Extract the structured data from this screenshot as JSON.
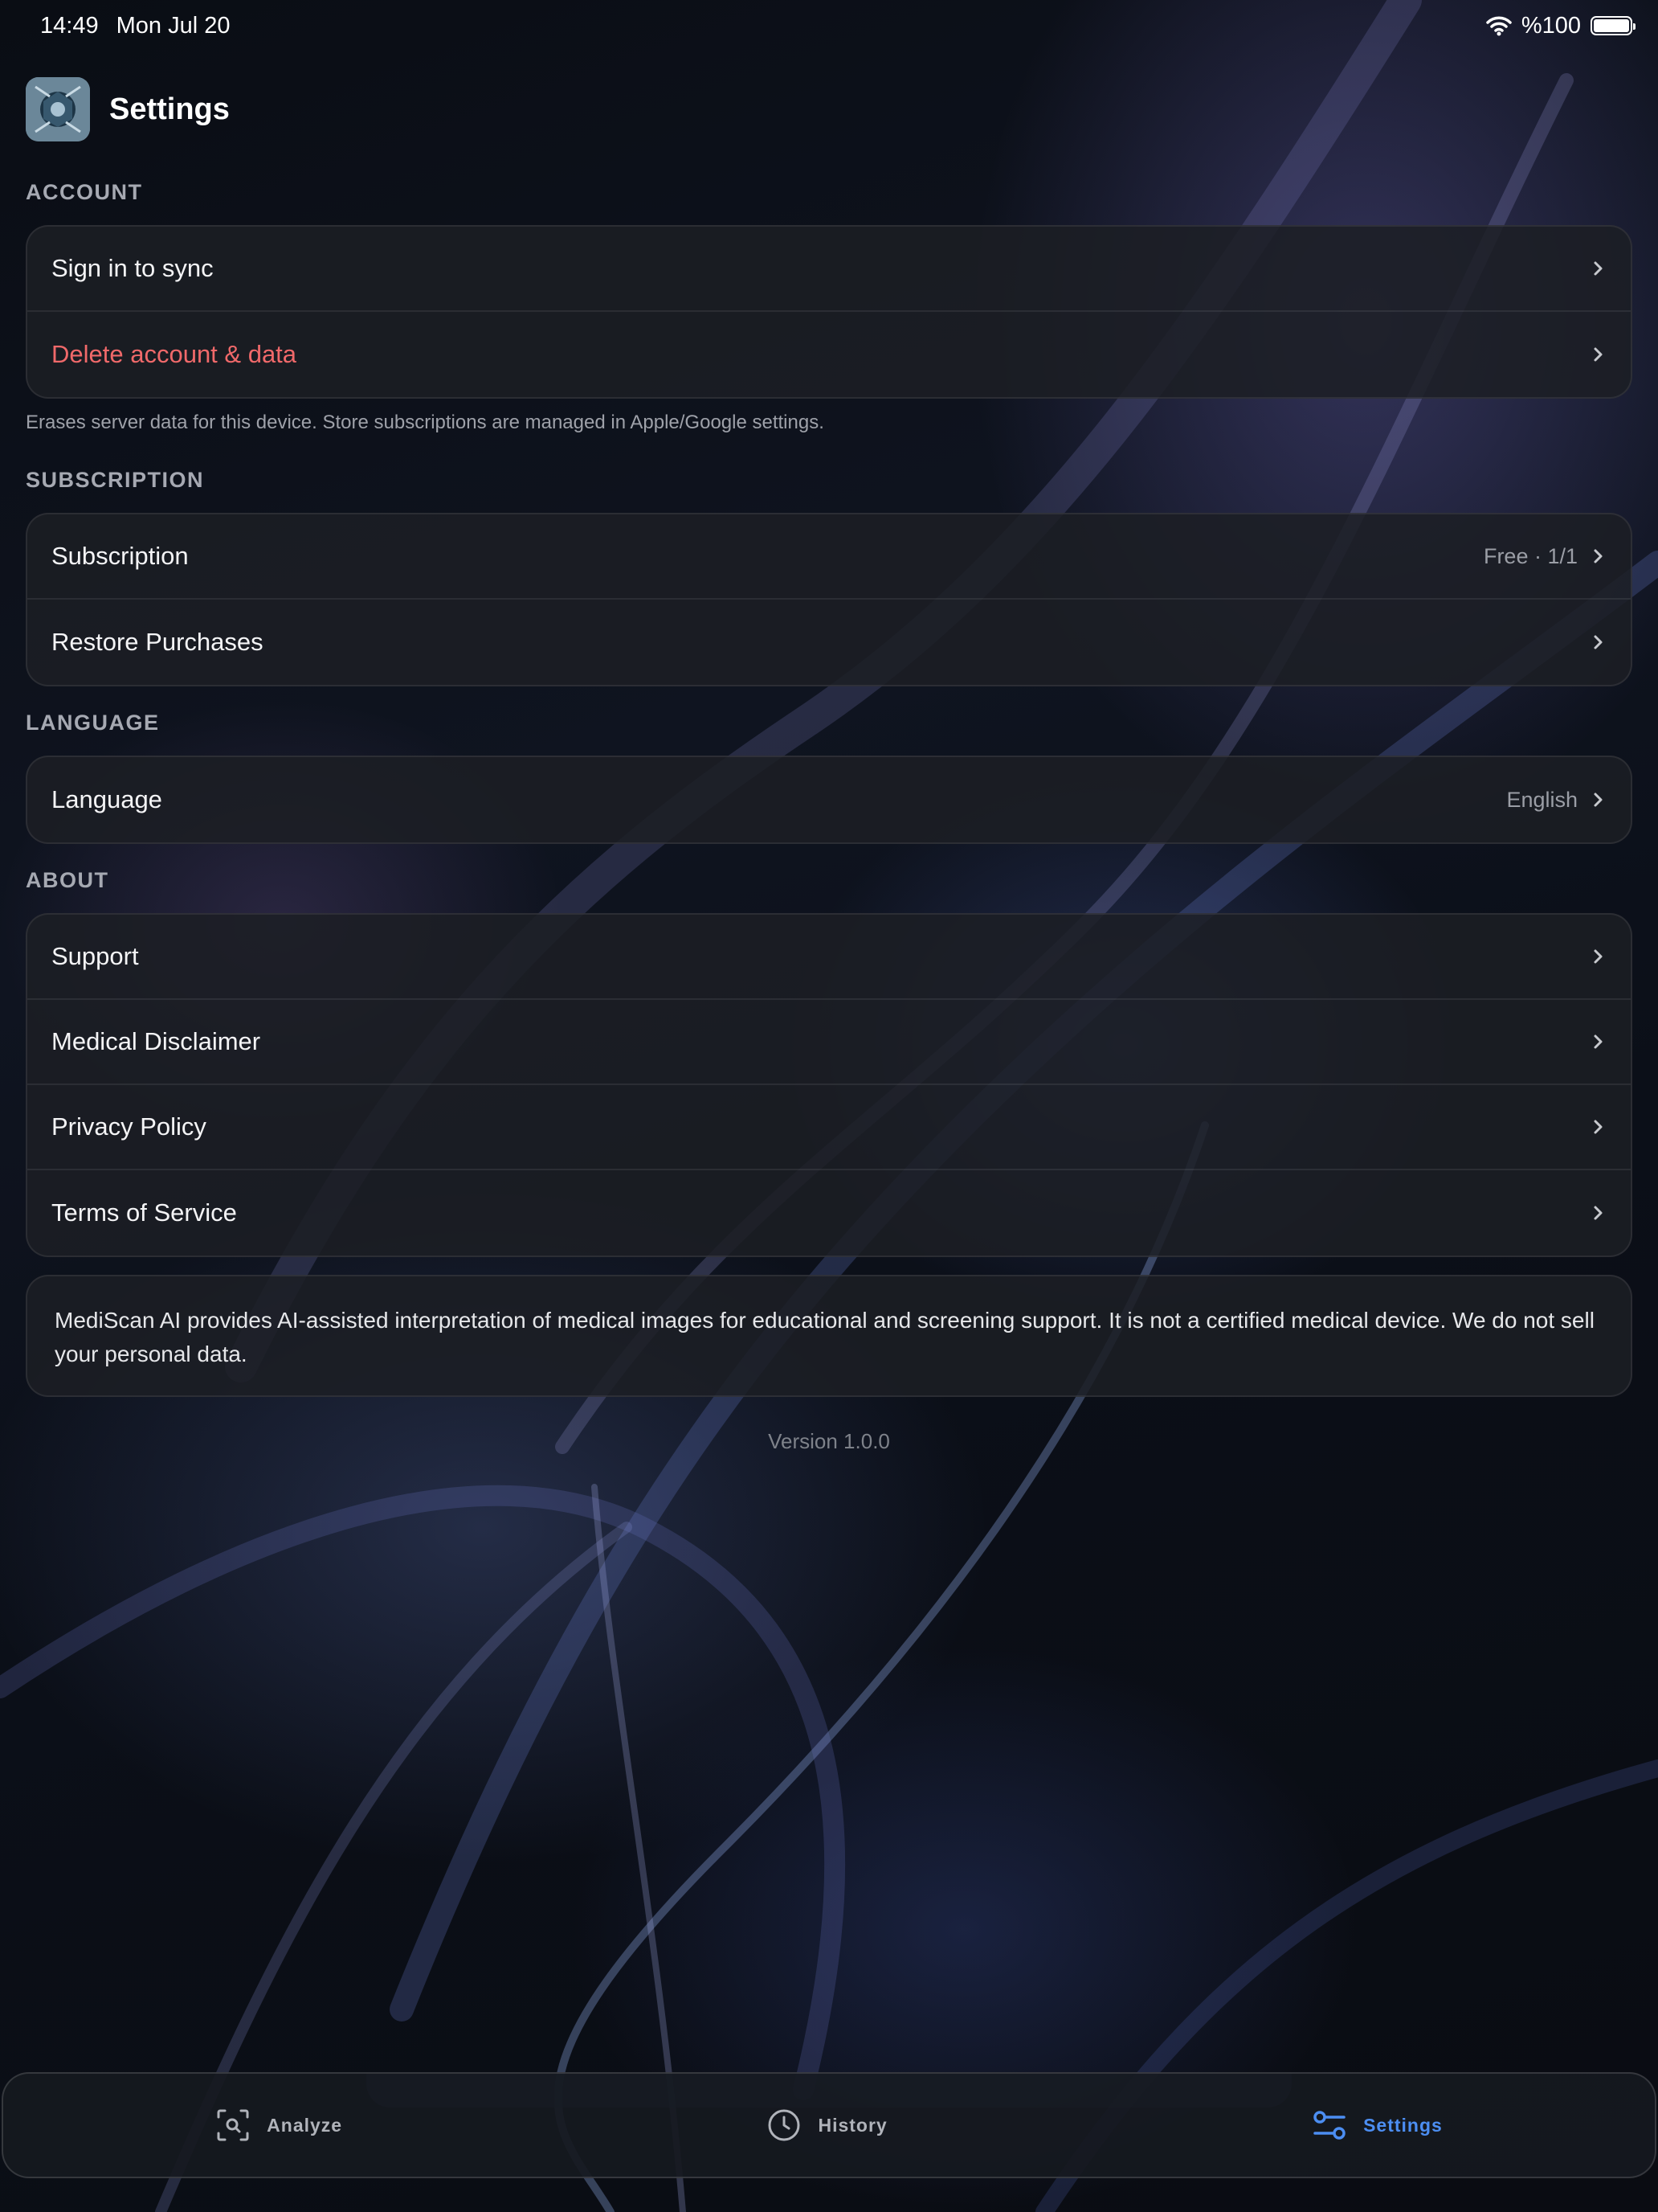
{
  "status_bar": {
    "time": "14:49",
    "date": "Mon Jul 20",
    "battery": "%100"
  },
  "header": {
    "title": "Settings"
  },
  "sections": {
    "account": {
      "label": "ACCOUNT",
      "rows": [
        {
          "label": "Sign in to sync"
        },
        {
          "label": "Delete account & data"
        }
      ],
      "footnote": "Erases server data for this device. Store subscriptions are managed in Apple/Google settings."
    },
    "subscription": {
      "label": "SUBSCRIPTION",
      "rows": [
        {
          "label": "Subscription",
          "value": "Free · 1/1"
        },
        {
          "label": "Restore Purchases"
        }
      ]
    },
    "language": {
      "label": "LANGUAGE",
      "rows": [
        {
          "label": "Language",
          "value": "English"
        }
      ]
    },
    "about": {
      "label": "ABOUT",
      "rows": [
        {
          "label": "Support"
        },
        {
          "label": "Medical Disclaimer"
        },
        {
          "label": "Privacy Policy"
        },
        {
          "label": "Terms of Service"
        }
      ]
    }
  },
  "about_text": "MediScan AI provides AI-assisted interpretation of medical images for educational and screening support. It is not a certified medical device. We do not sell your personal data.",
  "version": "Version 1.0.0",
  "tabbar": {
    "tabs": [
      {
        "label": "Analyze",
        "icon": "scan-search-icon"
      },
      {
        "label": "History",
        "icon": "clock-icon"
      },
      {
        "label": "Settings",
        "icon": "sliders-icon"
      }
    ],
    "active": "Settings"
  },
  "colors": {
    "accent": "#4c8ef2",
    "danger": "#f0696a"
  }
}
